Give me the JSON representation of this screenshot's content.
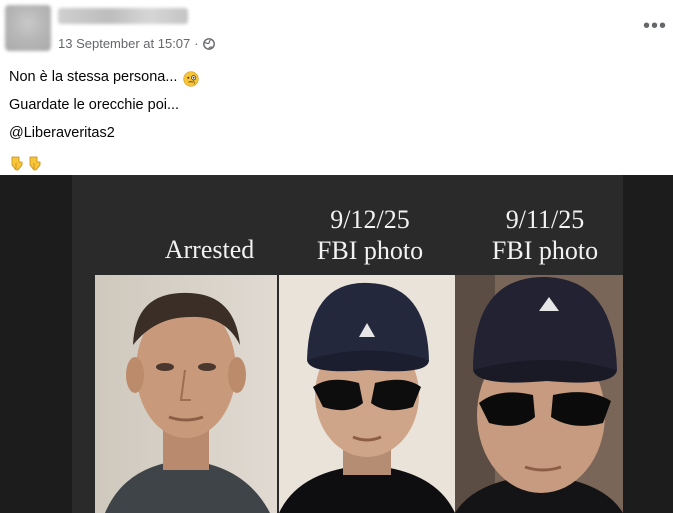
{
  "post": {
    "timestamp": "13 September at 15:07",
    "separator": "·",
    "privacy_icon": "globe-icon",
    "more_icon": "more-options-icon",
    "lines": [
      "Non è la stessa persona...",
      "Guardate le orecchie poi...",
      "@Liberaveritas2"
    ],
    "emoji_line1": "face-with-monocle-emoji",
    "emoji_line4": [
      "pointing-down-emoji",
      "pointing-down-emoji"
    ]
  },
  "image": {
    "captions": [
      {
        "line1": "",
        "line2": "Arrested"
      },
      {
        "line1": "9/12/25",
        "line2": "FBI photo"
      },
      {
        "line1": "9/11/25",
        "line2": "FBI photo"
      }
    ],
    "colors": {
      "background": "#2a2a2a",
      "outer": "#1c1c1c",
      "text": "#f2f2f2"
    }
  }
}
